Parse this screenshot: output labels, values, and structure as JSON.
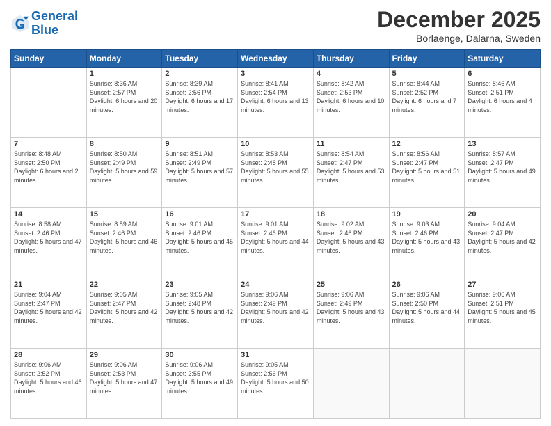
{
  "header": {
    "logo_line1": "General",
    "logo_line2": "Blue",
    "month_title": "December 2025",
    "location": "Borlaenge, Dalarna, Sweden"
  },
  "weekdays": [
    "Sunday",
    "Monday",
    "Tuesday",
    "Wednesday",
    "Thursday",
    "Friday",
    "Saturday"
  ],
  "weeks": [
    [
      {
        "day": "",
        "sunrise": "",
        "sunset": "",
        "daylight": ""
      },
      {
        "day": "1",
        "sunrise": "Sunrise: 8:36 AM",
        "sunset": "Sunset: 2:57 PM",
        "daylight": "Daylight: 6 hours and 20 minutes."
      },
      {
        "day": "2",
        "sunrise": "Sunrise: 8:39 AM",
        "sunset": "Sunset: 2:56 PM",
        "daylight": "Daylight: 6 hours and 17 minutes."
      },
      {
        "day": "3",
        "sunrise": "Sunrise: 8:41 AM",
        "sunset": "Sunset: 2:54 PM",
        "daylight": "Daylight: 6 hours and 13 minutes."
      },
      {
        "day": "4",
        "sunrise": "Sunrise: 8:42 AM",
        "sunset": "Sunset: 2:53 PM",
        "daylight": "Daylight: 6 hours and 10 minutes."
      },
      {
        "day": "5",
        "sunrise": "Sunrise: 8:44 AM",
        "sunset": "Sunset: 2:52 PM",
        "daylight": "Daylight: 6 hours and 7 minutes."
      },
      {
        "day": "6",
        "sunrise": "Sunrise: 8:46 AM",
        "sunset": "Sunset: 2:51 PM",
        "daylight": "Daylight: 6 hours and 4 minutes."
      }
    ],
    [
      {
        "day": "7",
        "sunrise": "Sunrise: 8:48 AM",
        "sunset": "Sunset: 2:50 PM",
        "daylight": "Daylight: 6 hours and 2 minutes."
      },
      {
        "day": "8",
        "sunrise": "Sunrise: 8:50 AM",
        "sunset": "Sunset: 2:49 PM",
        "daylight": "Daylight: 5 hours and 59 minutes."
      },
      {
        "day": "9",
        "sunrise": "Sunrise: 8:51 AM",
        "sunset": "Sunset: 2:49 PM",
        "daylight": "Daylight: 5 hours and 57 minutes."
      },
      {
        "day": "10",
        "sunrise": "Sunrise: 8:53 AM",
        "sunset": "Sunset: 2:48 PM",
        "daylight": "Daylight: 5 hours and 55 minutes."
      },
      {
        "day": "11",
        "sunrise": "Sunrise: 8:54 AM",
        "sunset": "Sunset: 2:47 PM",
        "daylight": "Daylight: 5 hours and 53 minutes."
      },
      {
        "day": "12",
        "sunrise": "Sunrise: 8:56 AM",
        "sunset": "Sunset: 2:47 PM",
        "daylight": "Daylight: 5 hours and 51 minutes."
      },
      {
        "day": "13",
        "sunrise": "Sunrise: 8:57 AM",
        "sunset": "Sunset: 2:47 PM",
        "daylight": "Daylight: 5 hours and 49 minutes."
      }
    ],
    [
      {
        "day": "14",
        "sunrise": "Sunrise: 8:58 AM",
        "sunset": "Sunset: 2:46 PM",
        "daylight": "Daylight: 5 hours and 47 minutes."
      },
      {
        "day": "15",
        "sunrise": "Sunrise: 8:59 AM",
        "sunset": "Sunset: 2:46 PM",
        "daylight": "Daylight: 5 hours and 46 minutes."
      },
      {
        "day": "16",
        "sunrise": "Sunrise: 9:01 AM",
        "sunset": "Sunset: 2:46 PM",
        "daylight": "Daylight: 5 hours and 45 minutes."
      },
      {
        "day": "17",
        "sunrise": "Sunrise: 9:01 AM",
        "sunset": "Sunset: 2:46 PM",
        "daylight": "Daylight: 5 hours and 44 minutes."
      },
      {
        "day": "18",
        "sunrise": "Sunrise: 9:02 AM",
        "sunset": "Sunset: 2:46 PM",
        "daylight": "Daylight: 5 hours and 43 minutes."
      },
      {
        "day": "19",
        "sunrise": "Sunrise: 9:03 AM",
        "sunset": "Sunset: 2:46 PM",
        "daylight": "Daylight: 5 hours and 43 minutes."
      },
      {
        "day": "20",
        "sunrise": "Sunrise: 9:04 AM",
        "sunset": "Sunset: 2:47 PM",
        "daylight": "Daylight: 5 hours and 42 minutes."
      }
    ],
    [
      {
        "day": "21",
        "sunrise": "Sunrise: 9:04 AM",
        "sunset": "Sunset: 2:47 PM",
        "daylight": "Daylight: 5 hours and 42 minutes."
      },
      {
        "day": "22",
        "sunrise": "Sunrise: 9:05 AM",
        "sunset": "Sunset: 2:47 PM",
        "daylight": "Daylight: 5 hours and 42 minutes."
      },
      {
        "day": "23",
        "sunrise": "Sunrise: 9:05 AM",
        "sunset": "Sunset: 2:48 PM",
        "daylight": "Daylight: 5 hours and 42 minutes."
      },
      {
        "day": "24",
        "sunrise": "Sunrise: 9:06 AM",
        "sunset": "Sunset: 2:49 PM",
        "daylight": "Daylight: 5 hours and 42 minutes."
      },
      {
        "day": "25",
        "sunrise": "Sunrise: 9:06 AM",
        "sunset": "Sunset: 2:49 PM",
        "daylight": "Daylight: 5 hours and 43 minutes."
      },
      {
        "day": "26",
        "sunrise": "Sunrise: 9:06 AM",
        "sunset": "Sunset: 2:50 PM",
        "daylight": "Daylight: 5 hours and 44 minutes."
      },
      {
        "day": "27",
        "sunrise": "Sunrise: 9:06 AM",
        "sunset": "Sunset: 2:51 PM",
        "daylight": "Daylight: 5 hours and 45 minutes."
      }
    ],
    [
      {
        "day": "28",
        "sunrise": "Sunrise: 9:06 AM",
        "sunset": "Sunset: 2:52 PM",
        "daylight": "Daylight: 5 hours and 46 minutes."
      },
      {
        "day": "29",
        "sunrise": "Sunrise: 9:06 AM",
        "sunset": "Sunset: 2:53 PM",
        "daylight": "Daylight: 5 hours and 47 minutes."
      },
      {
        "day": "30",
        "sunrise": "Sunrise: 9:06 AM",
        "sunset": "Sunset: 2:55 PM",
        "daylight": "Daylight: 5 hours and 49 minutes."
      },
      {
        "day": "31",
        "sunrise": "Sunrise: 9:05 AM",
        "sunset": "Sunset: 2:56 PM",
        "daylight": "Daylight: 5 hours and 50 minutes."
      },
      {
        "day": "",
        "sunrise": "",
        "sunset": "",
        "daylight": ""
      },
      {
        "day": "",
        "sunrise": "",
        "sunset": "",
        "daylight": ""
      },
      {
        "day": "",
        "sunrise": "",
        "sunset": "",
        "daylight": ""
      }
    ]
  ]
}
